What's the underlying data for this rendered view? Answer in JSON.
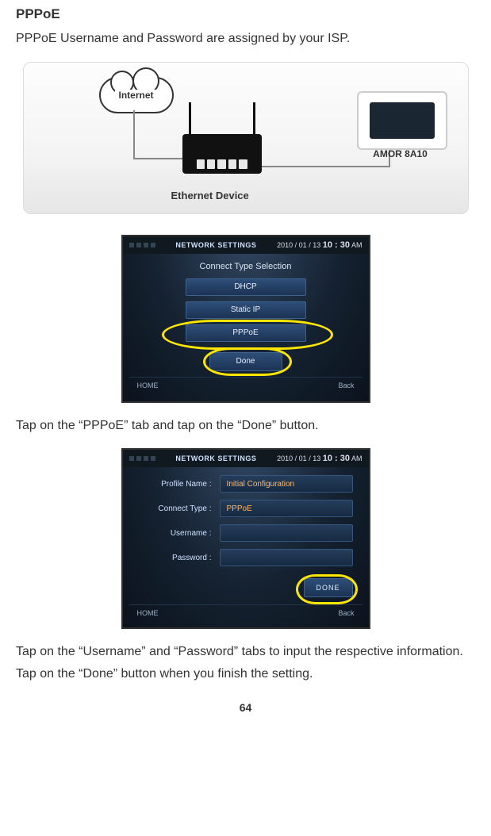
{
  "title": "PPPoE",
  "intro": "PPPoE Username and Password are assigned by your ISP.",
  "diagram": {
    "cloud_label": "Internet",
    "device_label": "AMOR 8A10",
    "ethernet_label": "Ethernet Device"
  },
  "ui1": {
    "header": "NETWORK SETTINGS",
    "date": "2010 / 01 / 13",
    "clock": "10 : 30",
    "ampm": "AM",
    "panel_title": "Connect Type Selection",
    "opt_dhcp": "DHCP",
    "opt_static": "Static IP",
    "opt_pppoe": "PPPoE",
    "done": "Done",
    "home": "HOME",
    "back": "Back"
  },
  "step1_text": "Tap on the “PPPoE” tab and tap on the “Done” button.",
  "ui2": {
    "header": "NETWORK SETTINGS",
    "date": "2010 / 01 / 13",
    "clock": "10 : 30",
    "ampm": "AM",
    "row_profile_lbl": "Profile Name :",
    "row_profile_val": "Initial Configuration",
    "row_ctype_lbl": "Connect Type :",
    "row_ctype_val": "PPPoE",
    "row_user_lbl": "Username :",
    "row_user_val": "",
    "row_pass_lbl": "Password :",
    "row_pass_val": "",
    "done": "DONE",
    "home": "HOME",
    "back": "Back"
  },
  "step2a_text": "Tap on the “Username” and “Password” tabs to input the respective information.",
  "step2b_text": "Tap on the “Done” button when you finish the setting.",
  "page_number": "64"
}
